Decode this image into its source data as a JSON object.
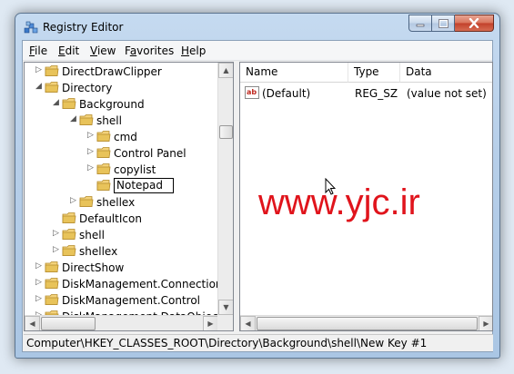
{
  "window": {
    "title": "Registry Editor"
  },
  "menu": {
    "file": {
      "accel": "F",
      "rest": "ile"
    },
    "edit": {
      "accel": "E",
      "rest": "dit"
    },
    "view": {
      "accel": "V",
      "rest": "iew"
    },
    "favorites": {
      "pre": "F",
      "accel": "a",
      "rest": "vorites"
    },
    "help": {
      "accel": "H",
      "rest": "elp"
    }
  },
  "tree": {
    "items": [
      {
        "label": "DirectDrawClipper",
        "expander": "▷"
      },
      {
        "label": "Directory",
        "expander": "◢"
      },
      {
        "label": "Background",
        "expander": "◢"
      },
      {
        "label": "shell",
        "expander": "◢"
      },
      {
        "label": "cmd",
        "expander": "▷"
      },
      {
        "label": "Control Panel",
        "expander": "▷"
      },
      {
        "label": "copylist",
        "expander": "▷"
      },
      {
        "label": "Notepad",
        "expander": ""
      },
      {
        "label": "shellex",
        "expander": "▷"
      },
      {
        "label": "DefaultIcon",
        "expander": ""
      },
      {
        "label": "shell",
        "expander": "▷"
      },
      {
        "label": "shellex",
        "expander": "▷"
      },
      {
        "label": "DirectShow",
        "expander": "▷"
      },
      {
        "label": "DiskManagement.Connection",
        "expander": "▷"
      },
      {
        "label": "DiskManagement.Control",
        "expander": "▷"
      },
      {
        "label": "DiskManagement.DataObject",
        "expander": "▷"
      }
    ]
  },
  "list": {
    "columns": {
      "name": "Name",
      "type": "Type",
      "data": "Data"
    },
    "rows": [
      {
        "name": "(Default)",
        "type": "REG_SZ",
        "data": "(value not set)"
      }
    ]
  },
  "watermark": "www.yjc.ir",
  "status": {
    "path": "Computer\\HKEY_CLASSES_ROOT\\Directory\\Background\\shell\\New Key #1"
  },
  "colors": {
    "watermark": "#e0141c",
    "folder": "#e8c35a",
    "close_button": "#c2402a"
  }
}
